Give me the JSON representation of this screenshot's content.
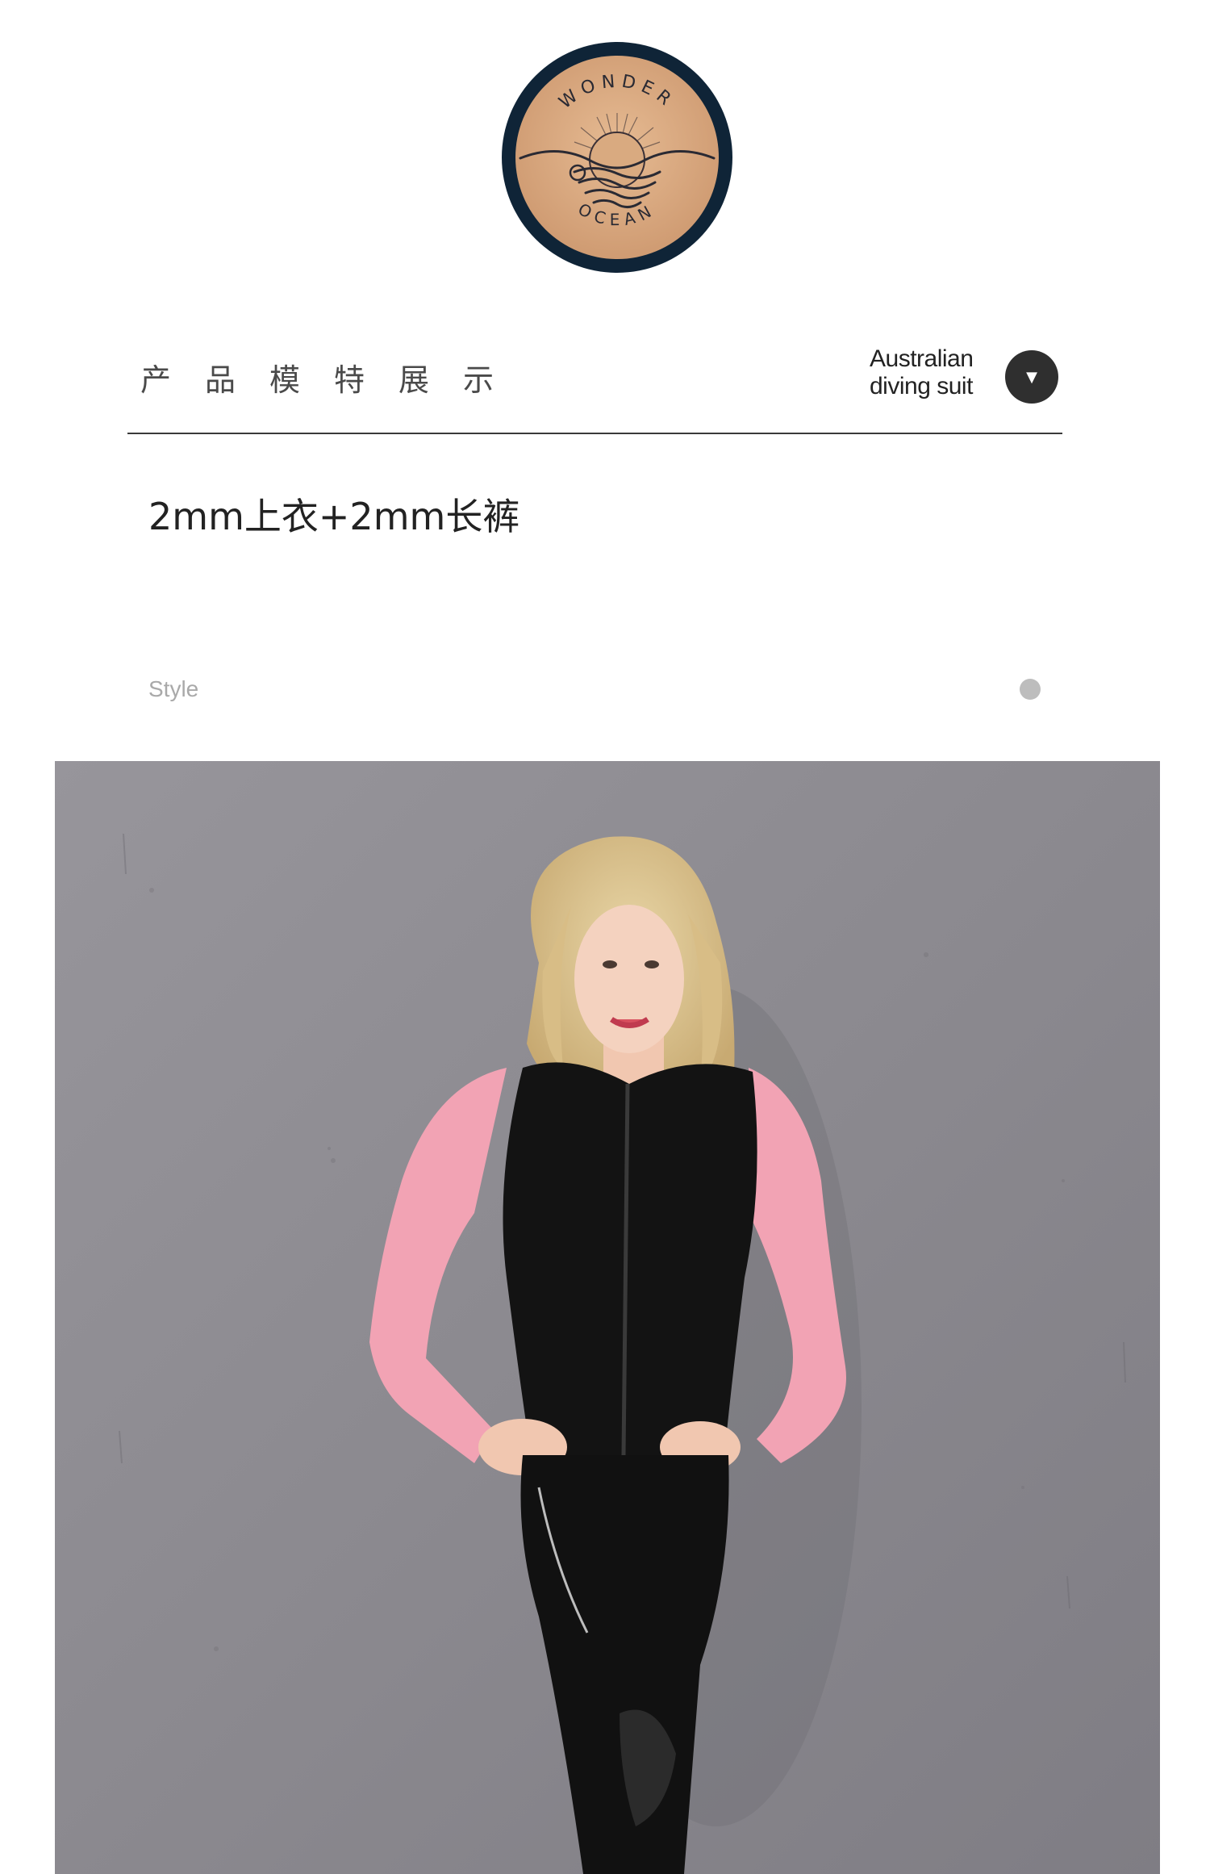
{
  "logo": {
    "top_text": "WONDER",
    "bottom_text": "OCEAN",
    "colors": {
      "ring": "#0f2437",
      "fill": "#d9aa80"
    }
  },
  "header": {
    "section_title": "产品模特展示",
    "brand_tag": {
      "line1": "Australian",
      "line2": "diving suit"
    },
    "dropdown_icon": "chevron-down-icon"
  },
  "product": {
    "spec": "2mm上衣+2mm长裤"
  },
  "style_row": {
    "label": "Style"
  },
  "photo": {
    "subject": "model-in-wetsuit-photo",
    "colors": {
      "wall": "#8f8d93",
      "suit_black": "#121212",
      "sleeve_pink": "#f2a3b4"
    }
  }
}
